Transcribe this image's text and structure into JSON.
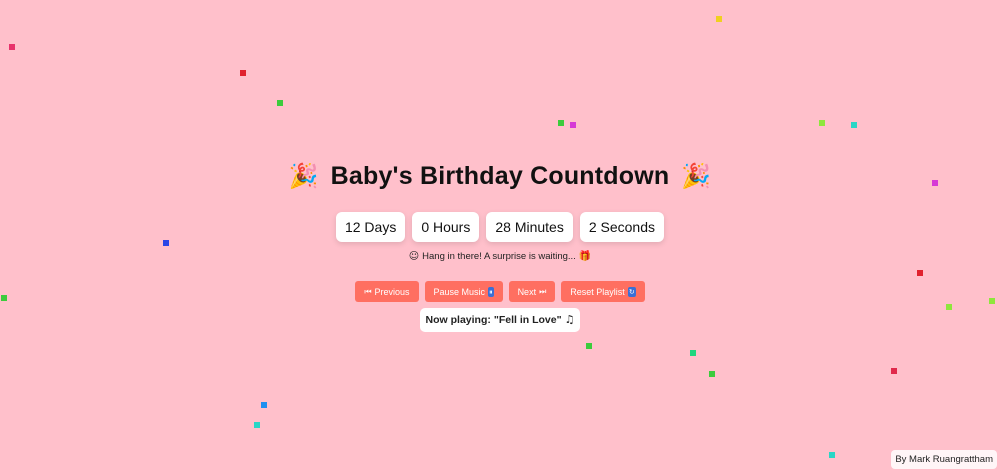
{
  "header": {
    "title": "Baby's Birthday Countdown",
    "left_icon": "party-popper-icon",
    "right_icon": "party-popper-icon"
  },
  "countdown": {
    "days": "12 Days",
    "hours": "0 Hours",
    "minutes": "28 Minutes",
    "seconds": "2 Seconds"
  },
  "message": {
    "text": "Hang in there! A surprise is waiting...",
    "lead_icon": "smiling-face-icon",
    "trail_icon": "gift-icon"
  },
  "controls": {
    "previous_label": "Previous",
    "pause_label": "Pause Music",
    "next_label": "Next",
    "reset_label": "Reset Playlist"
  },
  "now_playing": {
    "prefix": "Now playing:",
    "song": "\"Fell in Love\"",
    "icon": "music-note-icon"
  },
  "footer": {
    "credit": "By Mark Ruangrattham"
  },
  "colors": {
    "background": "#ffc0cb",
    "button": "#ff6f61",
    "card": "#ffffff"
  },
  "confetti_colors": [
    "#e8326b",
    "#e0222e",
    "#3ccb3c",
    "#f0d020",
    "#d63ad6",
    "#29d6c6",
    "#2a46e6",
    "#1f8ff0",
    "#8ee63c",
    "#1ed67e",
    "#e0294b"
  ]
}
